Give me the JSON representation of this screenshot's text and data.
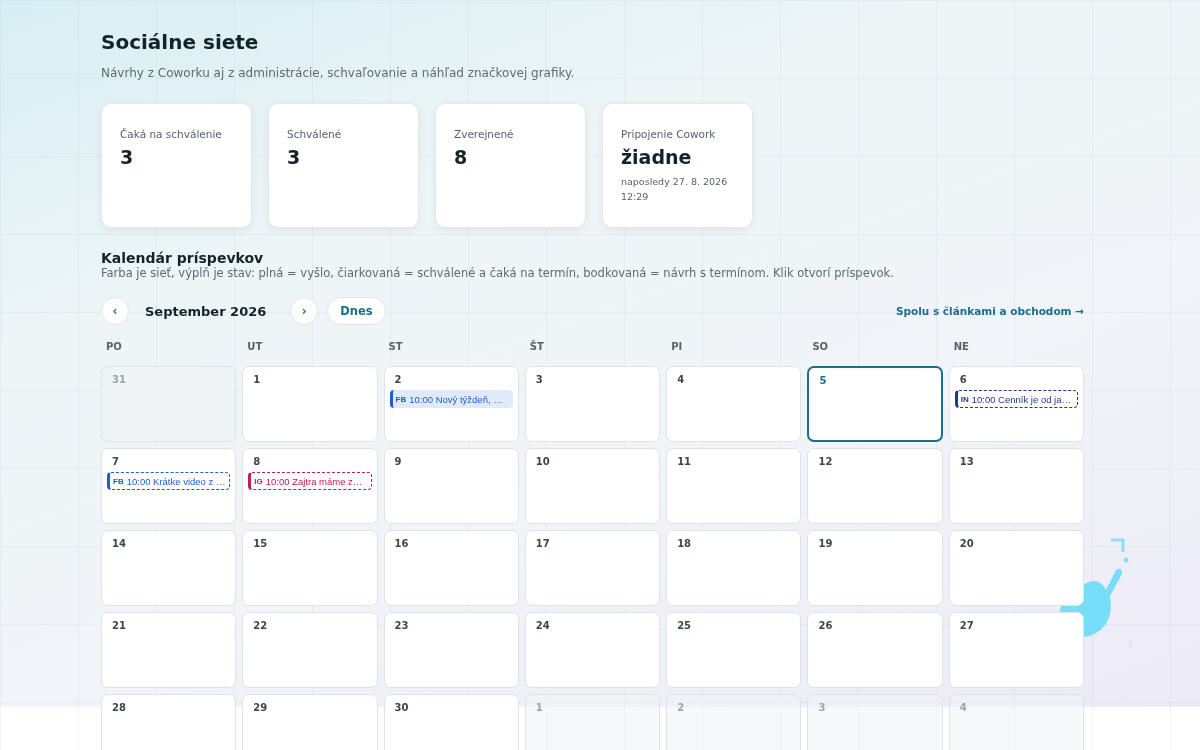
{
  "header": {
    "title": "Sociálne siete",
    "subtitle": "Návrhy z Coworku aj z administrácie, schvaľovanie a náhľad značkovej grafiky."
  },
  "stats": [
    {
      "label": "Čaká na schválenie",
      "value": "3"
    },
    {
      "label": "Schválené",
      "value": "3"
    },
    {
      "label": "Zverejnené",
      "value": "8"
    },
    {
      "label": "Pripojenie Cowork",
      "value": "žiadne",
      "note": "naposledy 27. 8. 2026 12:29"
    }
  ],
  "calendar": {
    "title": "Kalendár príspevkov",
    "legend": "Farba je sieť, výplň je stav: plná = vyšlo, čiarkovaná = schválené a čaká na termín, bodkovaná = návrh s termínom. Klik otvorí príspevok.",
    "prev": "‹",
    "month": "September 2026",
    "next": "›",
    "today_button": "Dnes",
    "link": "Spolu s článkami a obchodom →",
    "weekdays": [
      "PO",
      "UT",
      "ST",
      "ŠT",
      "PI",
      "SO",
      "NE"
    ],
    "weeks": [
      [
        {
          "day": "31",
          "outside": true,
          "selected": false
        },
        {
          "day": "1",
          "outside": false,
          "selected": false
        },
        {
          "day": "2",
          "outside": false,
          "selected": false,
          "events": [
            {
              "kind": "published",
              "network": "FB",
              "color": "#1d5fd1",
              "text": "10:00 Nový týždeň, …"
            }
          ]
        },
        {
          "day": "3",
          "outside": false,
          "selected": false
        },
        {
          "day": "4",
          "outside": false,
          "selected": false
        },
        {
          "day": "5",
          "outside": false,
          "selected": true
        },
        {
          "day": "6",
          "outside": false,
          "selected": false,
          "events": [
            {
              "kind": "approved",
              "network": "IN",
              "color": "#1e3a8a",
              "text": "10:00 Cenník je od ja…"
            }
          ]
        }
      ],
      [
        {
          "day": "7",
          "outside": false,
          "selected": false,
          "events": [
            {
              "kind": "approved",
              "network": "FB",
              "color": "#1d5fd1",
              "text": "10:00 Krátke video z …"
            }
          ]
        },
        {
          "day": "8",
          "outside": false,
          "selected": false,
          "events": [
            {
              "kind": "approved",
              "network": "IG",
              "color": "#be1e5a",
              "text": "10:00 Zajtra máme z…"
            }
          ]
        },
        {
          "day": "9",
          "outside": false,
          "selected": false
        },
        {
          "day": "10",
          "outside": false,
          "selected": false
        },
        {
          "day": "11",
          "outside": false,
          "selected": false
        },
        {
          "day": "12",
          "outside": false,
          "selected": false
        },
        {
          "day": "13",
          "outside": false,
          "selected": false
        }
      ],
      [
        {
          "day": "14",
          "outside": false,
          "selected": false
        },
        {
          "day": "15",
          "outside": false,
          "selected": false
        },
        {
          "day": "16",
          "outside": false,
          "selected": false
        },
        {
          "day": "17",
          "outside": false,
          "selected": false
        },
        {
          "day": "18",
          "outside": false,
          "selected": false
        },
        {
          "day": "19",
          "outside": false,
          "selected": false
        },
        {
          "day": "20",
          "outside": false,
          "selected": false
        }
      ],
      [
        {
          "day": "21",
          "outside": false,
          "selected": false
        },
        {
          "day": "22",
          "outside": false,
          "selected": false
        },
        {
          "day": "23",
          "outside": false,
          "selected": false
        },
        {
          "day": "24",
          "outside": false,
          "selected": false
        },
        {
          "day": "25",
          "outside": false,
          "selected": false
        },
        {
          "day": "26",
          "outside": false,
          "selected": false
        },
        {
          "day": "27",
          "outside": false,
          "selected": false
        }
      ],
      [
        {
          "day": "28",
          "outside": false,
          "selected": false
        },
        {
          "day": "29",
          "outside": false,
          "selected": false
        },
        {
          "day": "30",
          "outside": false,
          "selected": false
        },
        {
          "day": "1",
          "outside": true,
          "selected": false
        },
        {
          "day": "2",
          "outside": true,
          "selected": false
        },
        {
          "day": "3",
          "outside": true,
          "selected": false
        },
        {
          "day": "4",
          "outside": true,
          "selected": false
        }
      ]
    ]
  }
}
